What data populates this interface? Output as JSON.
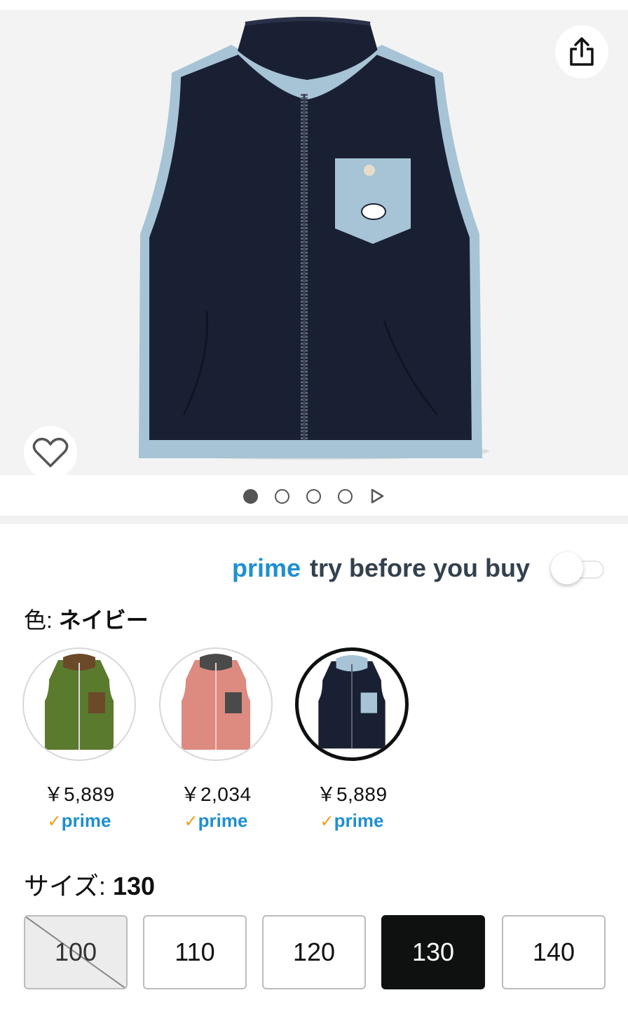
{
  "product": {
    "share_icon": "share-icon",
    "wishlist_icon": "heart-outline-icon",
    "colors": {
      "vest_navy": "#1a2033",
      "trim_blue": "#a7c4d6",
      "prime_blue": "#1f8fd0",
      "prime_check": "#f39c12"
    }
  },
  "carousel": {
    "pages": 4,
    "active_index": 0,
    "next_icon": "play-triangle-icon"
  },
  "prime_try": {
    "logo": "prime",
    "text": "try before you buy",
    "toggle_on": false
  },
  "color_selector": {
    "label": "色:",
    "value": "ネイビー",
    "options": [
      {
        "name": "green",
        "price": "￥5,889",
        "prime_check": "✓",
        "prime_text": "prime",
        "body": "#5a7a2e",
        "trim": "#6b4a2a",
        "selected": false
      },
      {
        "name": "pink",
        "price": "￥2,034",
        "prime_check": "✓",
        "prime_text": "prime",
        "body": "#dd8a80",
        "trim": "#4a4a4a",
        "selected": false
      },
      {
        "name": "navy",
        "price": "￥5,889",
        "prime_check": "✓",
        "prime_text": "prime",
        "body": "#1a2033",
        "trim": "#a7c4d6",
        "selected": true
      }
    ]
  },
  "size_selector": {
    "label": "サイズ:",
    "value": "130",
    "sizes": [
      {
        "label": "100",
        "available": false,
        "selected": false
      },
      {
        "label": "110",
        "available": true,
        "selected": false
      },
      {
        "label": "120",
        "available": true,
        "selected": false
      },
      {
        "label": "130",
        "available": true,
        "selected": true
      },
      {
        "label": "140",
        "available": true,
        "selected": false
      }
    ]
  }
}
